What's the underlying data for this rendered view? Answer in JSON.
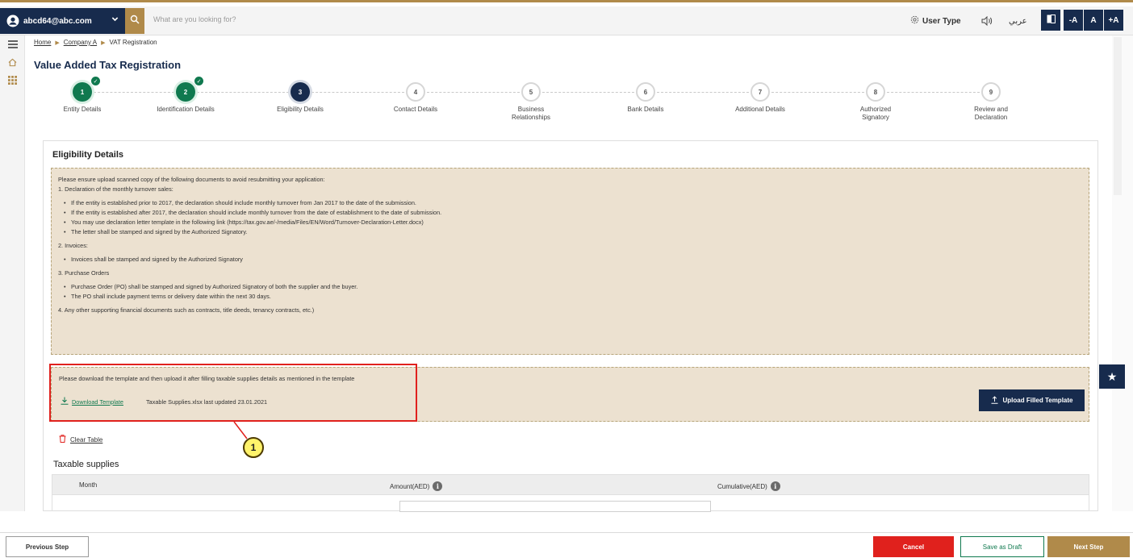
{
  "colors": {
    "navy": "#172b4d",
    "gold": "#b08a4a",
    "green": "#10794f",
    "red": "#e0211d",
    "beige": "#ece1d0"
  },
  "topbar": {
    "account": "abcd64@abc.com",
    "search_placeholder": "What are you looking for?",
    "user_type": "User Type",
    "arabic": "عربي",
    "font_minus": "-A",
    "font_normal": "A",
    "font_plus": "+A"
  },
  "breadcrumb": {
    "home": "Home",
    "company": "Company A",
    "current": "VAT Registration"
  },
  "page_title": "Value Added Tax Registration",
  "steps": [
    {
      "num": "1",
      "label": "Entity Details",
      "state": "done"
    },
    {
      "num": "2",
      "label": "Identification Details",
      "state": "done"
    },
    {
      "num": "3",
      "label": "Eligibility Details",
      "state": "current"
    },
    {
      "num": "4",
      "label": "Contact Details",
      "state": "pending"
    },
    {
      "num": "5",
      "label": "Business Relationships",
      "state": "pending"
    },
    {
      "num": "6",
      "label": "Bank Details",
      "state": "pending"
    },
    {
      "num": "7",
      "label": "Additional Details",
      "state": "pending"
    },
    {
      "num": "8",
      "label": "Authorized Signatory",
      "state": "pending"
    },
    {
      "num": "9",
      "label": "Review and Declaration",
      "state": "pending"
    }
  ],
  "panel": {
    "title": "Eligibility Details",
    "notice": {
      "intro": "Please ensure upload scanned copy of the following documents to avoid resubmitting your application:",
      "s1": "1. Declaration of the monthly turnover sales:",
      "s1_items": [
        "If the entity is established prior to 2017, the declaration should include monthly turnover from Jan 2017 to the date of the submission.",
        "If the entity is established after 2017, the declaration should include monthly turnover from the date of establishment to the date of submission.",
        "You may use declaration letter template in the following link (https://tax.gov.ae/-/media/Files/EN/Word/Turnover-Declaration-Letter.docx)",
        "The letter shall be stamped and signed by the Authorized Signatory."
      ],
      "s2": "2. Invoices:",
      "s2_items": [
        "Invoices shall be stamped and signed by the Authorized Signatory"
      ],
      "s3": "3. Purchase Orders",
      "s3_items": [
        "Purchase Order (PO) shall be stamped and signed by Authorized Signatory of both the supplier and the buyer.",
        "The PO shall include payment terms or delivery date within the next 30 days."
      ],
      "s4": "4. Any other supporting financial documents such as contracts, title deeds, tenancy contracts, etc.)"
    },
    "template": {
      "message": "Please download the template and then upload it after filling taxable supplies details as mentioned in the template",
      "download_label": "Download Template",
      "file_info": "Taxable Supplies.xlsx last updated 23.01.2021",
      "upload_label": "Upload Filled Template"
    },
    "callout_number": "1",
    "clear_table": "Clear Table",
    "taxable_title": "Taxable supplies",
    "table_headers": {
      "month": "Month",
      "amount": "Amount(AED)",
      "cumulative": "Cumulative(AED)"
    }
  },
  "footer": {
    "previous": "Previous Step",
    "cancel": "Cancel",
    "draft": "Save as Draft",
    "next": "Next Step"
  }
}
